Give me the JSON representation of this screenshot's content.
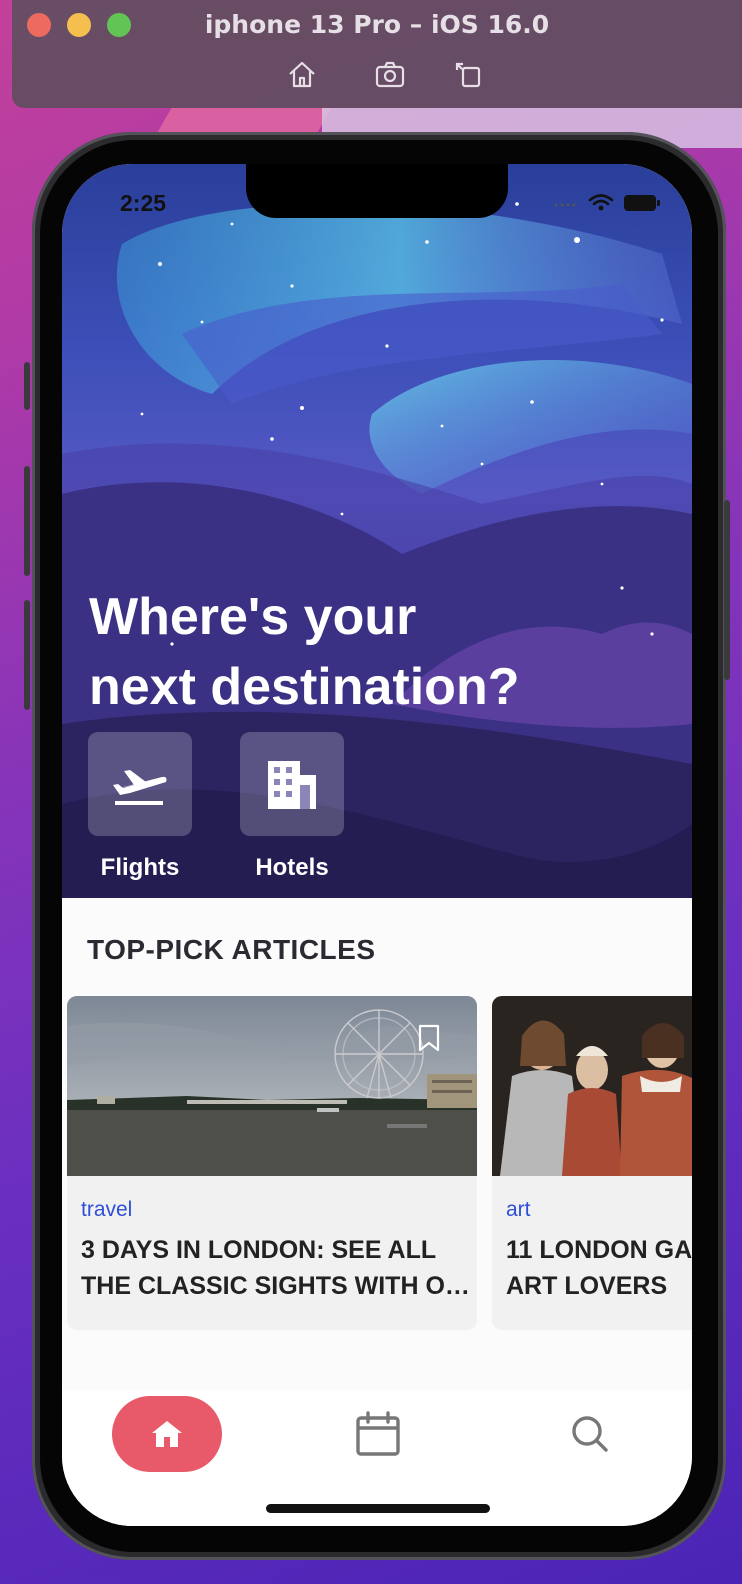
{
  "simulator": {
    "title": "iphone 13 Pro – iOS 16.0",
    "tools": [
      "home-icon",
      "screenshot-icon",
      "rotate-icon"
    ]
  },
  "status_bar": {
    "time": "2:25",
    "icons": [
      "signal-icon",
      "wifi-icon",
      "battery-icon"
    ]
  },
  "hero": {
    "title_line1": "Where's your",
    "title_line2": "next destination?",
    "quick_actions": [
      {
        "label": "Flights",
        "icon": "airplane-departure-icon"
      },
      {
        "label": "Hotels",
        "icon": "hotel-building-icon"
      }
    ]
  },
  "articles": {
    "section_title": "TOP-PICK ARTICLES",
    "items": [
      {
        "category": "travel",
        "title_line1": "3 DAYS IN LONDON: SEE ALL",
        "title_line2": "THE CLASSIC SIGHTS WITH O…",
        "bookmark_icon": "bookmark-icon"
      },
      {
        "category": "art",
        "title_line1": "11 LONDON GA",
        "title_line2": "ART LOVERS"
      }
    ]
  },
  "tab_bar": {
    "tabs": [
      {
        "icon": "home-icon",
        "active": true
      },
      {
        "icon": "calendar-icon",
        "active": false
      },
      {
        "icon": "search-icon",
        "active": false
      }
    ]
  },
  "colors": {
    "accent": "#e85a6a",
    "category": "#2f4fd8"
  }
}
